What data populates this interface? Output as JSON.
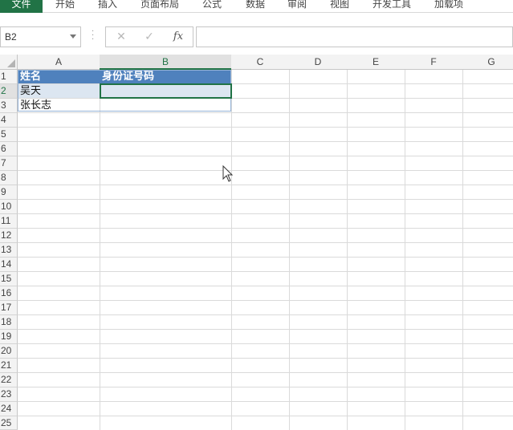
{
  "ribbon": {
    "tabs": [
      "文件",
      "开始",
      "插入",
      "页面布局",
      "公式",
      "数据",
      "审阅",
      "视图",
      "开发工具",
      "加载项"
    ]
  },
  "formula_bar": {
    "name_box": "B2",
    "cancel_icon": "✕",
    "enter_icon": "✓",
    "fx_label": "fx",
    "formula_value": ""
  },
  "grid": {
    "columns": [
      "A",
      "B",
      "C",
      "D",
      "E",
      "F",
      "G"
    ],
    "rows": [
      "1",
      "2",
      "3",
      "4",
      "5",
      "6",
      "7",
      "8",
      "9",
      "10",
      "11",
      "12",
      "13",
      "14",
      "15",
      "16",
      "17",
      "18",
      "19",
      "20",
      "21",
      "22",
      "23",
      "24",
      "25"
    ],
    "selected_cell": "B2"
  },
  "table": {
    "header": [
      "姓名",
      "身份证号码"
    ],
    "rows": [
      [
        "吴天",
        ""
      ],
      [
        "张长志",
        ""
      ]
    ]
  },
  "colors": {
    "header_fill": "#4f81bd",
    "band_fill": "#dce6f1",
    "file_tab": "#217346",
    "selection": "#217346"
  }
}
